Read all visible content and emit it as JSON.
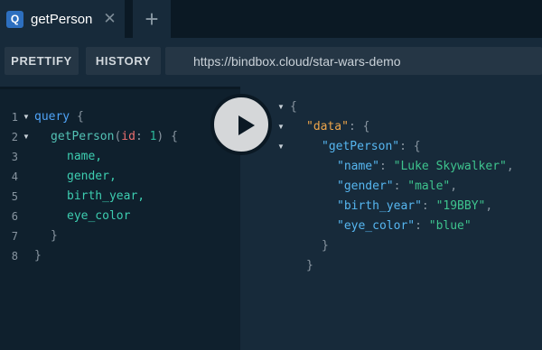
{
  "tabs": [
    {
      "icon_letter": "Q",
      "label": "getPerson",
      "close_glyph": "✕"
    }
  ],
  "new_tab_glyph": "+",
  "toolbar": {
    "prettify_label": "PRETTIFY",
    "history_label": "HISTORY",
    "url": "https://bindbox.cloud/star-wars-demo"
  },
  "editor": {
    "line_numbers": [
      "1",
      "2",
      "3",
      "4",
      "5",
      "6",
      "7",
      "8"
    ],
    "query_keyword": "query",
    "open_brace": "{",
    "operation": "getPerson",
    "open_paren": "(",
    "arg_name": "id",
    "colon": ":",
    "arg_value": "1",
    "close_paren": ")",
    "fields": [
      "name,",
      "gender,",
      "birth_year,",
      "eye_color"
    ],
    "close_brace": "}"
  },
  "result": {
    "open_brace": "{",
    "data_key": "\"data\"",
    "colon": ":",
    "operation_key": "\"getPerson\"",
    "entries": [
      {
        "key": "\"name\"",
        "value": "\"Luke Skywalker\"",
        "comma": ","
      },
      {
        "key": "\"gender\"",
        "value": "\"male\"",
        "comma": ","
      },
      {
        "key": "\"birth_year\"",
        "value": "\"19BBY\"",
        "comma": ","
      },
      {
        "key": "\"eye_color\"",
        "value": "\"blue\"",
        "comma": ""
      }
    ],
    "close_brace": "}"
  },
  "colors": {
    "keyword": "#4fa3f7",
    "field": "#3dcdb0",
    "argument": "#ec6f6f",
    "number": "#2cb99c",
    "json_key": "#56b6f0",
    "data_key": "#eda54b",
    "string": "#3ec48e"
  }
}
